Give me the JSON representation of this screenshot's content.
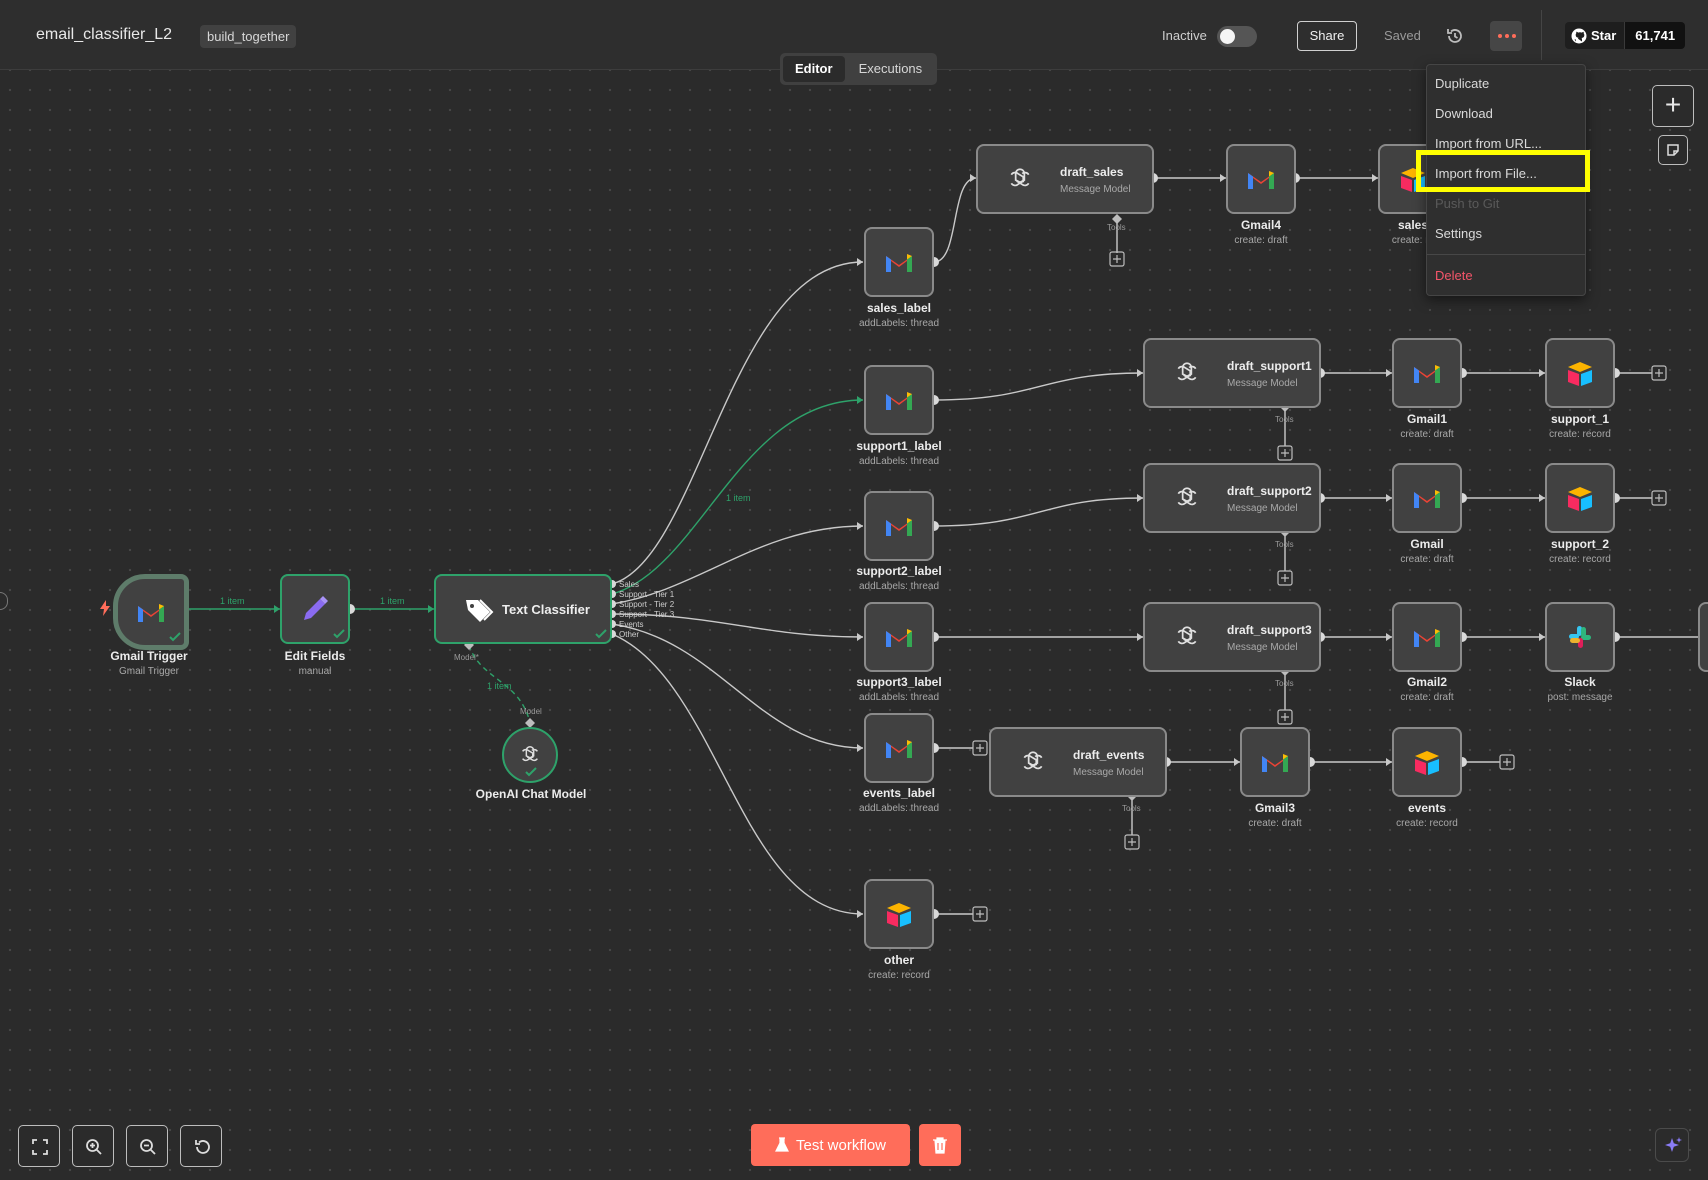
{
  "header": {
    "workflow_name": "email_classifier_L2",
    "tag": "build_together",
    "status_label": "Inactive",
    "share_label": "Share",
    "saved_label": "Saved",
    "github_star_label": "Star",
    "github_star_count": "61,741"
  },
  "tabs": [
    {
      "label": "Editor",
      "active": true
    },
    {
      "label": "Executions",
      "active": false
    }
  ],
  "menu": {
    "items": [
      {
        "label": "Duplicate",
        "state": "normal"
      },
      {
        "label": "Download",
        "state": "normal"
      },
      {
        "label": "Import from URL...",
        "state": "normal"
      },
      {
        "label": "Import from File...",
        "state": "highlighted"
      },
      {
        "label": "Push to Git",
        "state": "disabled"
      },
      {
        "label": "Settings",
        "state": "normal"
      },
      {
        "label": "Delete",
        "state": "danger"
      }
    ]
  },
  "nodes": {
    "gmail_trigger": {
      "title": "Gmail Trigger",
      "subtitle": "Gmail Trigger"
    },
    "edit_fields": {
      "title": "Edit Fields",
      "subtitle": "manual"
    },
    "text_classifier": {
      "title": "Text Classifier"
    },
    "openai_model": {
      "title": "OpenAI Chat Model"
    },
    "sales_label": {
      "title": "sales_label",
      "subtitle": "addLabels: thread"
    },
    "support1_label": {
      "title": "support1_label",
      "subtitle": "addLabels: thread"
    },
    "support2_label": {
      "title": "support2_label",
      "subtitle": "addLabels: thread"
    },
    "support3_label": {
      "title": "support3_label",
      "subtitle": "addLabels: thread"
    },
    "events_label": {
      "title": "events_label",
      "subtitle": "addLabels: thread"
    },
    "other": {
      "title": "other",
      "subtitle": "create: record"
    },
    "draft_sales": {
      "title": "draft_sales",
      "subtitle": "Message Model"
    },
    "draft_support1": {
      "title": "draft_support1",
      "subtitle": "Message Model"
    },
    "draft_support2": {
      "title": "draft_support2",
      "subtitle": "Message Model"
    },
    "draft_support3": {
      "title": "draft_support3",
      "subtitle": "Message Model"
    },
    "draft_events": {
      "title": "draft_events",
      "subtitle": "Message Model"
    },
    "gmail4": {
      "title": "Gmail4",
      "subtitle": "create: draft"
    },
    "gmail1": {
      "title": "Gmail1",
      "subtitle": "create: draft"
    },
    "gmail": {
      "title": "Gmail",
      "subtitle": "create: draft"
    },
    "gmail2": {
      "title": "Gmail2",
      "subtitle": "create: draft"
    },
    "gmail3": {
      "title": "Gmail3",
      "subtitle": "create: draft"
    },
    "sales": {
      "title": "sales",
      "subtitle": "create: re"
    },
    "support_1": {
      "title": "support_1",
      "subtitle": "create: record"
    },
    "support_2": {
      "title": "support_2",
      "subtitle": "create: record"
    },
    "slack": {
      "title": "Slack",
      "subtitle": "post: message"
    },
    "events": {
      "title": "events",
      "subtitle": "create: record"
    }
  },
  "connections": {
    "item_count_label": "1 item",
    "tools_label": "Tools",
    "model_label": "Model",
    "model_required_label": "Model*"
  },
  "classifier_outputs": [
    "Sales",
    "Support - Tier 1",
    "Support - Tier 2",
    "Support - Tier 3",
    "Events",
    "Other"
  ],
  "footer": {
    "test_workflow_label": "Test workflow"
  },
  "colors": {
    "accent": "#ff6d5a",
    "success": "#2ea26a",
    "highlight": "#ffff00",
    "danger": "#f5556a"
  }
}
